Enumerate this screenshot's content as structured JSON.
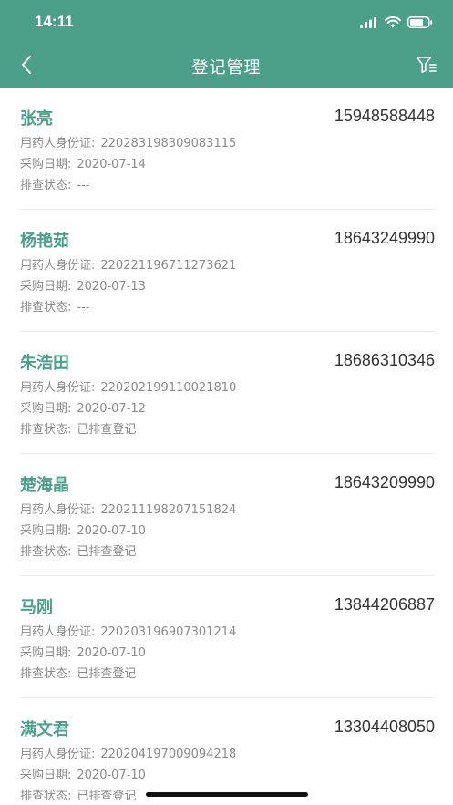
{
  "status_bar": {
    "time": "14:11"
  },
  "nav": {
    "title": "登记管理",
    "back_icon": "chevron-left-icon",
    "filter_icon": "filter-list-icon"
  },
  "labels": {
    "id_card": "用药人身份证:",
    "purchase_date": "采购日期:",
    "check_status": "排查状态:"
  },
  "colors": {
    "accent": "#4c9f88",
    "text_gray": "#8a8a8a",
    "phone_text": "#333333"
  },
  "records": [
    {
      "name": "张亮",
      "phone": "15948588448",
      "id_card": "220283198309083115",
      "purchase_date": "2020-07-14",
      "check_status": "---"
    },
    {
      "name": "杨艳茹",
      "phone": "18643249990",
      "id_card": "220221196711273621",
      "purchase_date": "2020-07-13",
      "check_status": "---"
    },
    {
      "name": "朱浩田",
      "phone": "18686310346",
      "id_card": "220202199110021810",
      "purchase_date": "2020-07-12",
      "check_status": "已排查登记"
    },
    {
      "name": "楚海晶",
      "phone": "18643209990",
      "id_card": "220211198207151824",
      "purchase_date": "2020-07-10",
      "check_status": "已排查登记"
    },
    {
      "name": "马刚",
      "phone": "13844206887",
      "id_card": "220203196907301214",
      "purchase_date": "2020-07-10",
      "check_status": "已排查登记"
    },
    {
      "name": "满文君",
      "phone": "13304408050",
      "id_card": "220204197009094218",
      "purchase_date": "2020-07-10",
      "check_status": "已排查登记"
    }
  ]
}
